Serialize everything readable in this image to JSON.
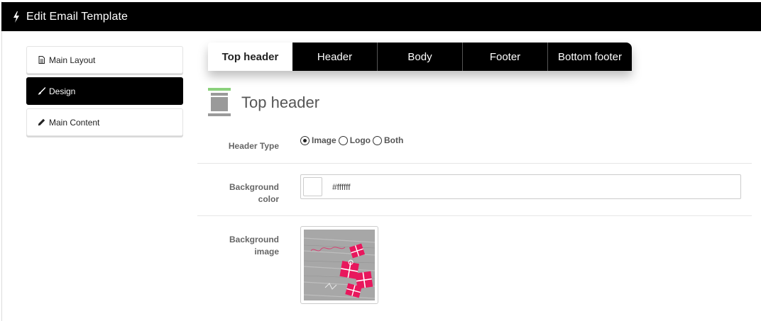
{
  "header": {
    "title": "Edit Email Template",
    "icon": "bolt-icon"
  },
  "sidebar": {
    "items": [
      {
        "label": "Main Layout",
        "icon": "document-icon",
        "active": false
      },
      {
        "label": "Design",
        "icon": "paint-brush-icon",
        "active": true
      },
      {
        "label": "Main Content",
        "icon": "pencil-icon",
        "active": false
      }
    ]
  },
  "tabs": [
    {
      "label": "Top header",
      "active": true
    },
    {
      "label": "Header",
      "active": false
    },
    {
      "label": "Body",
      "active": false
    },
    {
      "label": "Footer",
      "active": false
    },
    {
      "label": "Bottom footer",
      "active": false
    }
  ],
  "section": {
    "title": "Top header",
    "icon": "layout-top-section-icon"
  },
  "form": {
    "header_type": {
      "label": "Header Type",
      "options": [
        {
          "label": "Image",
          "checked": true
        },
        {
          "label": "Logo",
          "checked": false
        },
        {
          "label": "Both",
          "checked": false
        }
      ]
    },
    "background_color": {
      "label_line1": "Background",
      "label_line2": "color",
      "value": "#ffffff"
    },
    "background_image": {
      "label_line1": "Background",
      "label_line2": "image",
      "thumbnail": "pink-gift-boxes-on-wood"
    }
  },
  "colors": {
    "accent": "#000000",
    "section_icon_green": "#8bd17c",
    "gift_pink": "#e8175d"
  }
}
